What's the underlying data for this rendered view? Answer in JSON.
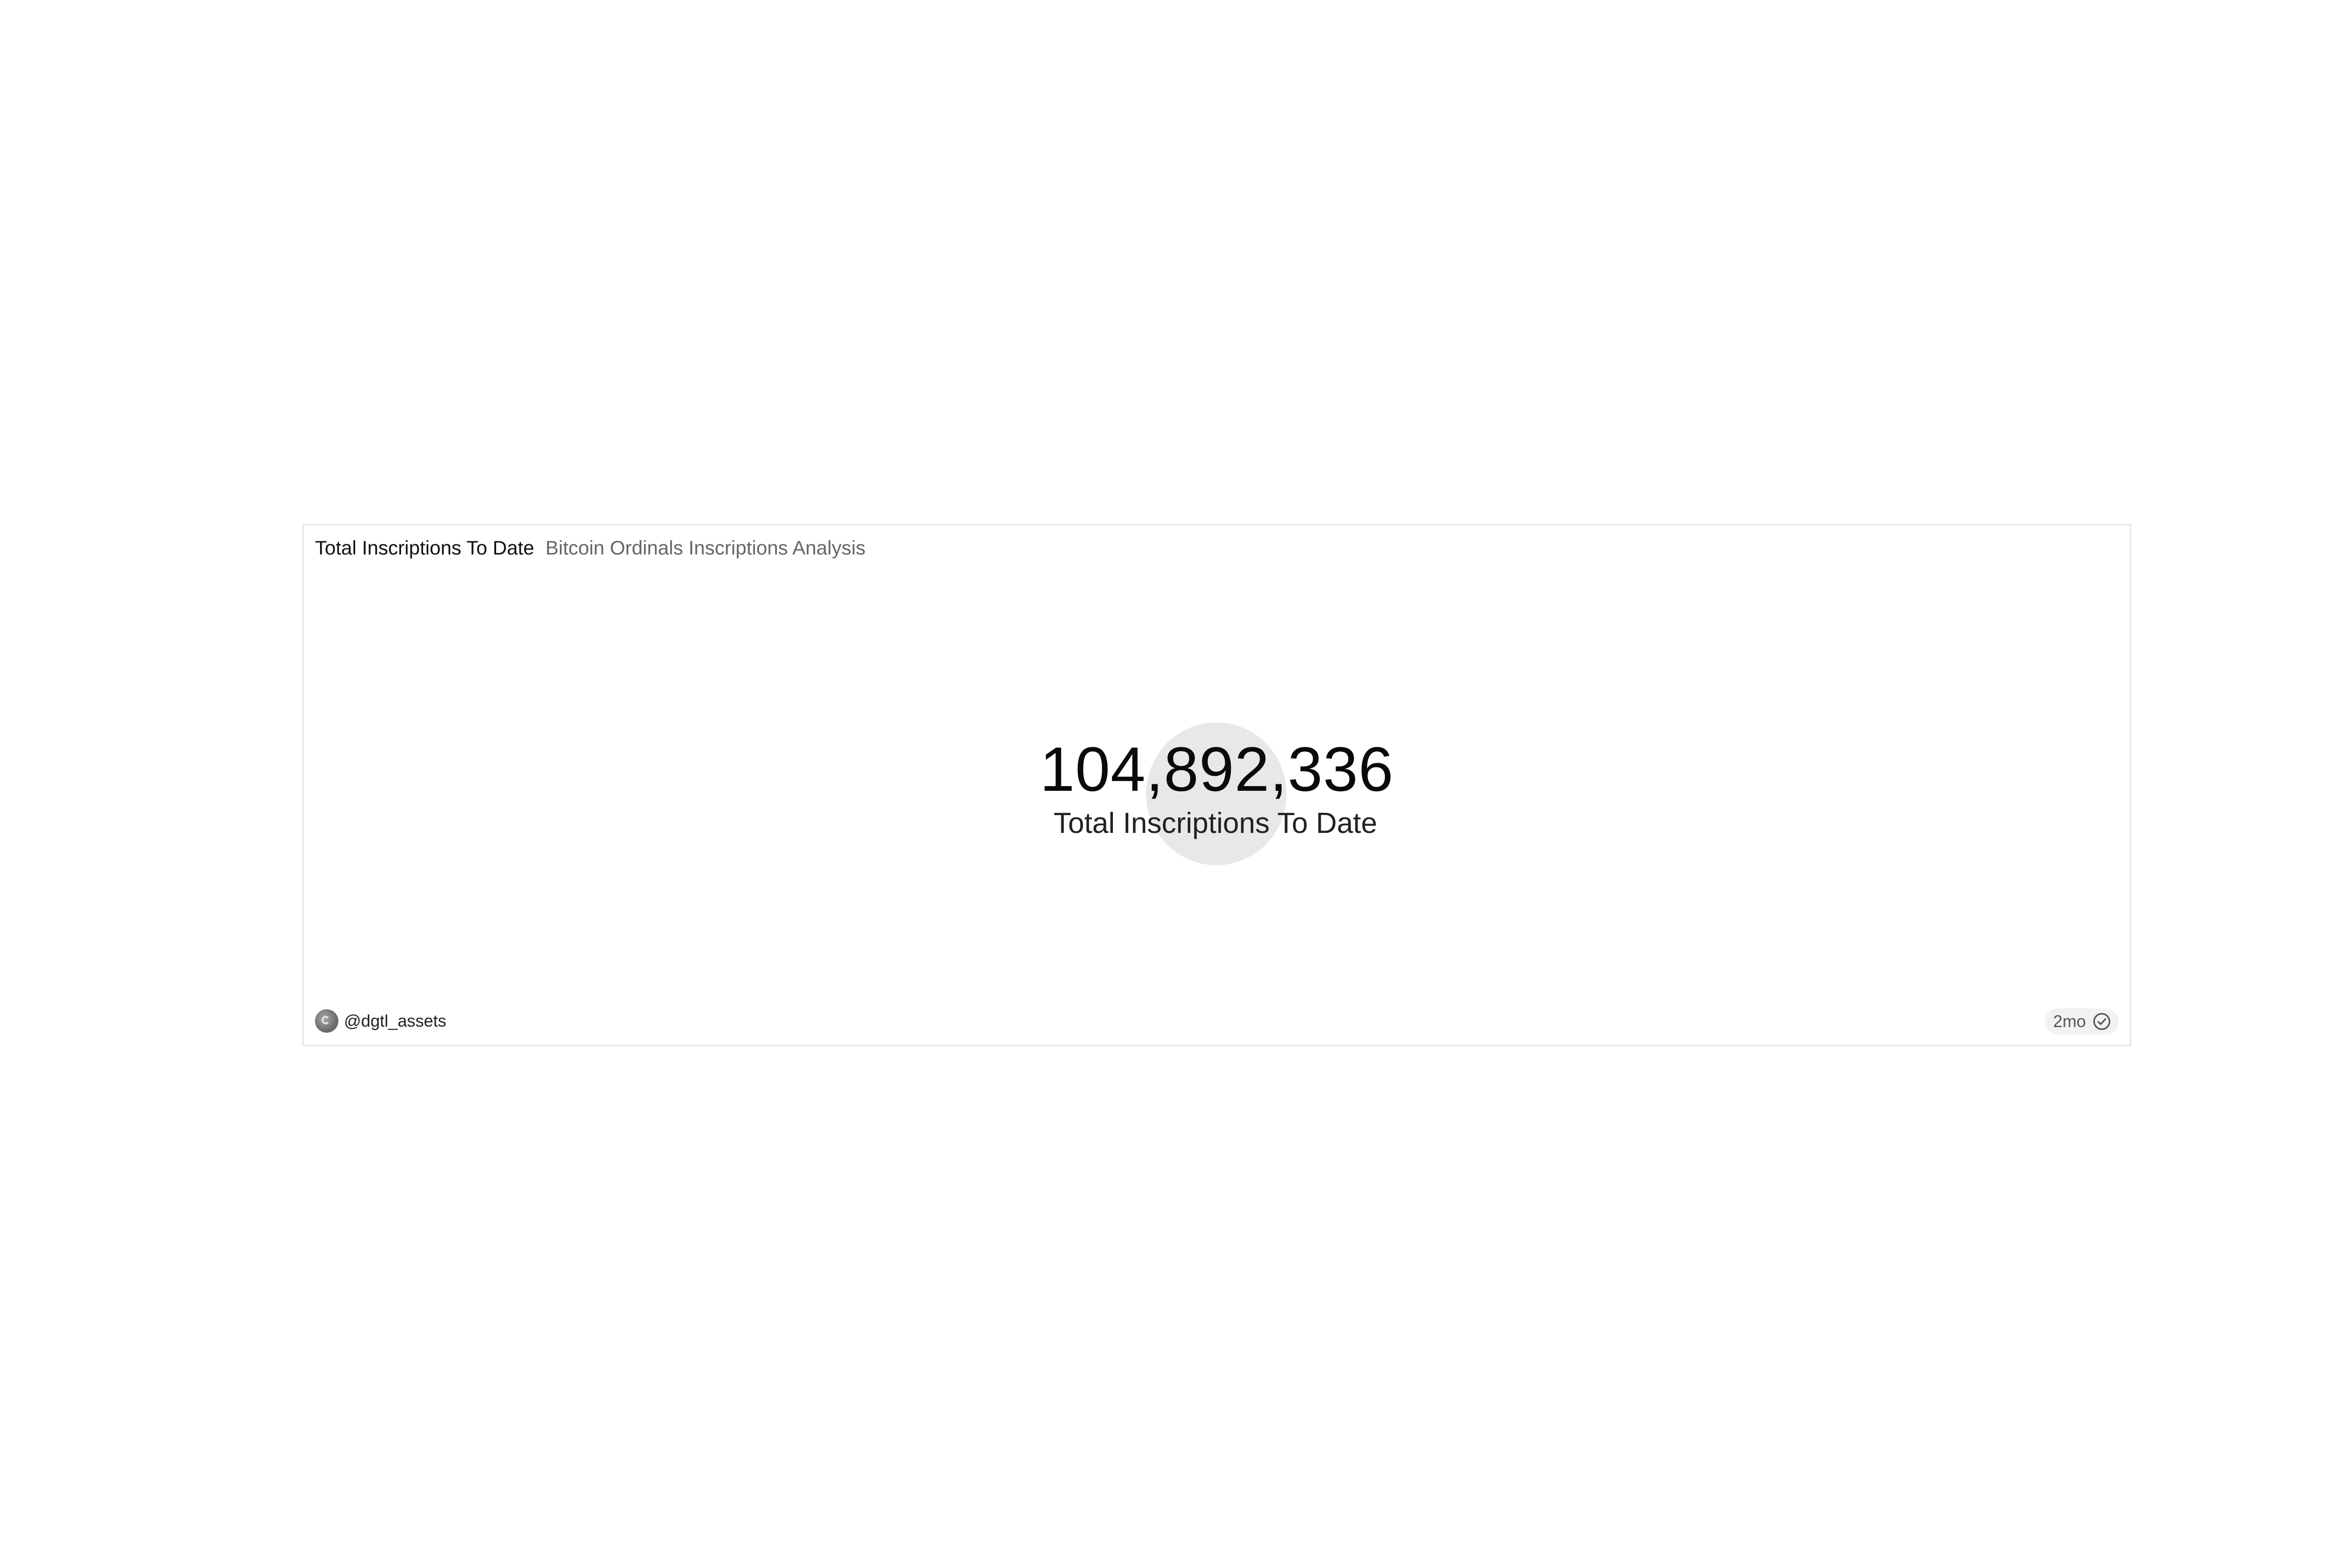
{
  "widget": {
    "title": "Total Inscriptions To Date",
    "subtitle": "Bitcoin Ordinals Inscriptions Analysis",
    "counter": {
      "value": "104,892,336",
      "label": "Total Inscriptions To Date"
    },
    "author": "@dgtl_assets",
    "age": "2mo",
    "icons": {
      "avatar": "user-avatar-icon",
      "status": "check-circle-icon"
    }
  }
}
